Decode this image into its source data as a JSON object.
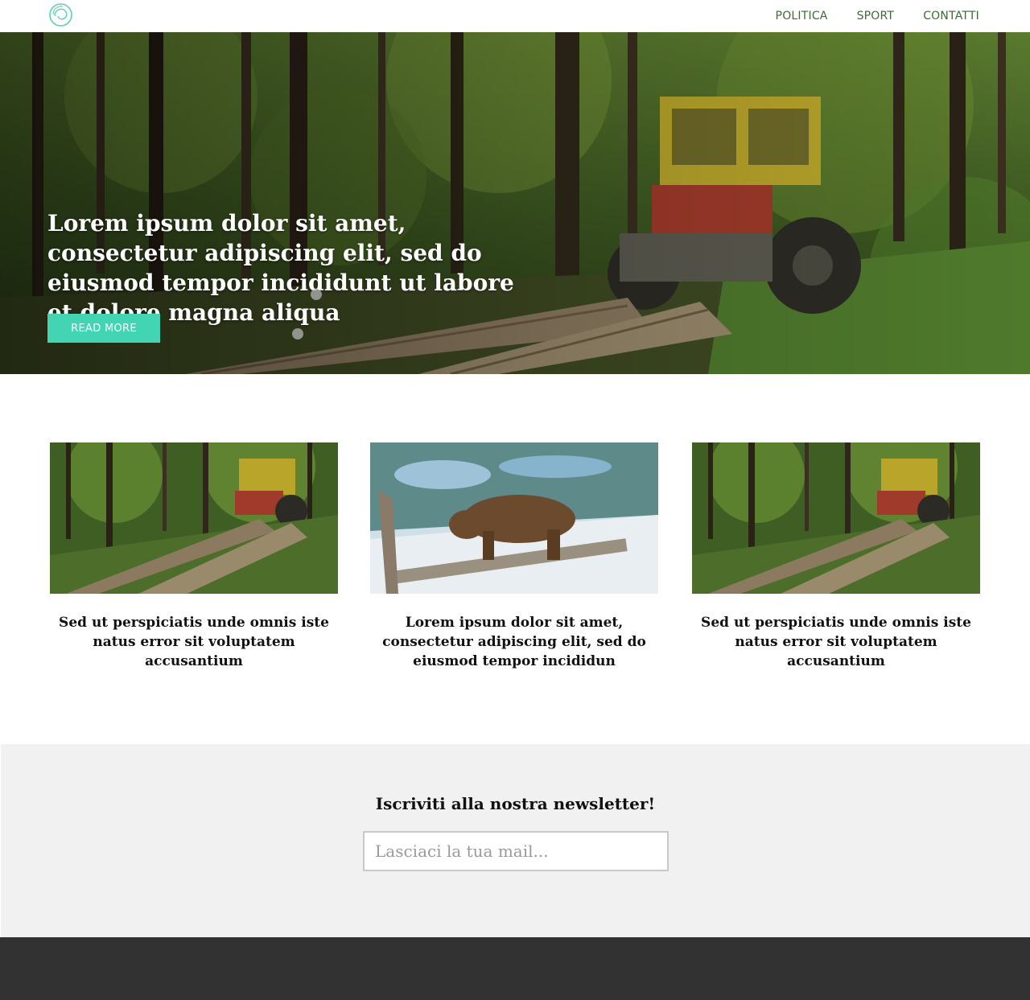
{
  "brand": {
    "logo_icon": "circle-swirl-logo-icon",
    "accent_color": "#43d4b3",
    "nav_color": "#3d6b36"
  },
  "nav": {
    "items": [
      {
        "label": "POLITICA"
      },
      {
        "label": "SPORT"
      },
      {
        "label": "CONTATTI"
      }
    ]
  },
  "hero": {
    "title": "Lorem ipsum dolor sit amet, consectetur adipiscing elit, sed do eiusmod tempor incididunt ut labore et dolore magna aliqua",
    "button_label": "READ MORE",
    "image": "forest-tractor-logs"
  },
  "cards": [
    {
      "image": "forest-tractor-logs",
      "title": "Sed ut perspiciatis unde omnis iste natus error sit voluptatem accusantium"
    },
    {
      "image": "bear-by-water",
      "title": "Lorem ipsum dolor sit amet, consectetur adipiscing elit, sed do eiusmod tempor incididun"
    },
    {
      "image": "forest-tractor-logs",
      "title": "Sed ut perspiciatis unde omnis iste natus error sit voluptatem accusantium"
    }
  ],
  "newsletter": {
    "title": "Iscriviti alla nostra newsletter!",
    "placeholder": "Lasciaci la tua mail..."
  }
}
